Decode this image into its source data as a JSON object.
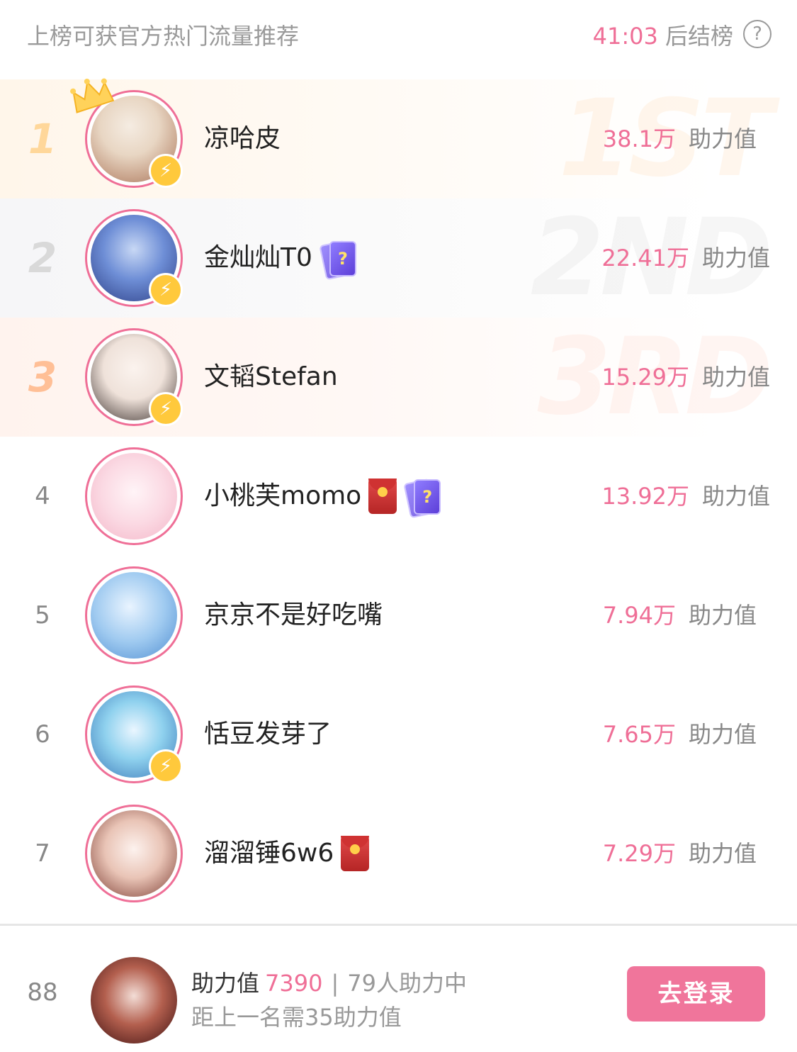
{
  "header": {
    "tip": "上榜可获官方热门流量推荐",
    "countdown_time": "41:03",
    "countdown_suffix": " 后结榜",
    "help_symbol": "?"
  },
  "ranking": [
    {
      "rank": "1",
      "name": "凉哈皮",
      "score": "38.1万",
      "unit": "助力值",
      "bg_word": "1ST",
      "badges": []
    },
    {
      "rank": "2",
      "name": "金灿灿T0",
      "score": "22.41万",
      "unit": "助力值",
      "bg_word": "2ND",
      "badges": [
        "card"
      ]
    },
    {
      "rank": "3",
      "name": "文韬Stefan",
      "score": "15.29万",
      "unit": "助力值",
      "bg_word": "3RD",
      "badges": []
    },
    {
      "rank": "4",
      "name": "小桃芙momo",
      "score": "13.92万",
      "unit": "助力值",
      "badges": [
        "redpack",
        "card"
      ]
    },
    {
      "rank": "5",
      "name": "京京不是好吃嘴",
      "score": "7.94万",
      "unit": "助力值",
      "badges": []
    },
    {
      "rank": "6",
      "name": "恬豆发芽了",
      "score": "7.65万",
      "unit": "助力值",
      "badges": []
    },
    {
      "rank": "7",
      "name": "溜溜锤6w6",
      "score": "7.29万",
      "unit": "助力值",
      "badges": [
        "redpack"
      ]
    }
  ],
  "me": {
    "rank": "88",
    "label": "助力值",
    "value": "7390",
    "separator": "|",
    "helpers": "79人助力中",
    "gap_text": "距上一名需35助力值",
    "login_label": "去登录"
  },
  "colors": {
    "accent": "#ef6f97",
    "button": "#f0759b",
    "bolt": "#ffc93c"
  },
  "icons": {
    "bolt": "lightning-bolt-icon",
    "crown": "crown-icon",
    "card": "mystery-card-icon",
    "redpack": "red-envelope-icon",
    "help": "question-mark-icon"
  }
}
